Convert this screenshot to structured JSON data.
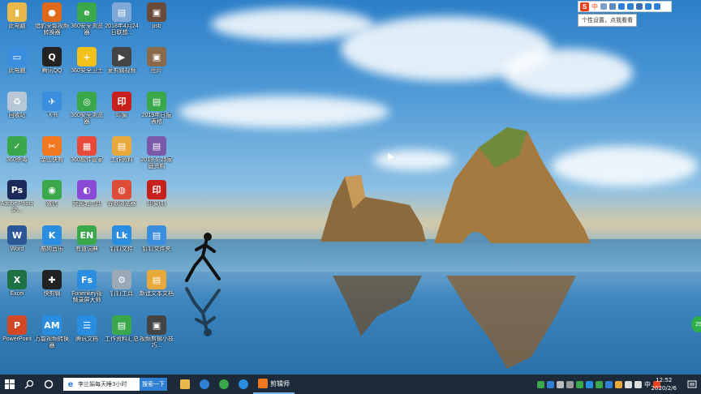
{
  "desktop": {
    "icons": [
      {
        "label": "此电脑",
        "icon": "folder-icon",
        "color": "#e8b94a",
        "glyph": "▮"
      },
      {
        "label": "猎豹全能视频转换器",
        "icon": "converter-icon",
        "color": "#e06a1b",
        "glyph": "●"
      },
      {
        "label": "360安全浏览器",
        "icon": "browser-360-icon",
        "color": "#3aa84a",
        "glyph": "e"
      },
      {
        "label": "2018年4月24日联想...",
        "icon": "document-icon",
        "color": "#7fa8d6",
        "glyph": "▤"
      },
      {
        "label": "psb",
        "icon": "image-thumb-icon",
        "color": "#6a4a3a",
        "glyph": "▣"
      },
      {
        "label": "此电脑",
        "icon": "computer-icon",
        "color": "#3b8ede",
        "glyph": "▭"
      },
      {
        "label": "腾讯QQ",
        "icon": "qq-icon",
        "color": "#222222",
        "glyph": "Q"
      },
      {
        "label": "360安全卫士",
        "icon": "shield-360-icon",
        "color": "#f2c21b",
        "glyph": "+"
      },
      {
        "label": "爱剪辑视频",
        "icon": "clapper-icon",
        "color": "#444444",
        "glyph": "▶"
      },
      {
        "label": "图片",
        "icon": "photo-icon",
        "color": "#8a6a4a",
        "glyph": "▣"
      },
      {
        "label": "回收站",
        "icon": "recycle-bin-icon",
        "color": "#b7c7d6",
        "glyph": "♻"
      },
      {
        "label": "飞书",
        "icon": "feishu-icon",
        "color": "#3b8ede",
        "glyph": "✈"
      },
      {
        "label": "360安全浏览器",
        "icon": "app-icon",
        "color": "#3aa84a",
        "glyph": "◎"
      },
      {
        "label": "印象",
        "icon": "stamp-icon",
        "color": "#c8201c",
        "glyph": "印"
      },
      {
        "label": "2019年日报表格",
        "icon": "spreadsheet-icon",
        "color": "#3aa84a",
        "glyph": "▤"
      },
      {
        "label": "360杀毒",
        "icon": "antivirus-icon",
        "color": "#3aa84a",
        "glyph": "✓"
      },
      {
        "label": "金山快剪",
        "icon": "scissors-icon",
        "color": "#f07820",
        "glyph": "✂"
      },
      {
        "label": "360软件管家",
        "icon": "software-manager-icon",
        "color": "#e84a3a",
        "glyph": "▦"
      },
      {
        "label": "工作资料",
        "icon": "document-icon",
        "color": "#e8a93a",
        "glyph": "▤"
      },
      {
        "label": "2019-6-25家庭资料",
        "icon": "document-icon",
        "color": "#7a5aa8",
        "glyph": "▤"
      },
      {
        "label": "Adobe Photosh...",
        "icon": "photoshop-icon",
        "color": "#1b2a5a",
        "glyph": "Ps"
      },
      {
        "label": "微信",
        "icon": "wechat-icon",
        "color": "#3aa84a",
        "glyph": "◉"
      },
      {
        "label": "荧光笔工具",
        "icon": "color-wheel-icon",
        "color": "#8a4ad6",
        "glyph": "◐"
      },
      {
        "label": "谷歌浏览器",
        "icon": "chrome-icon",
        "color": "#dd4b39",
        "glyph": "◍"
      },
      {
        "label": "印象(1)",
        "icon": "stamp-icon",
        "color": "#c8201c",
        "glyph": "印"
      },
      {
        "label": "Word",
        "icon": "word-icon",
        "color": "#2b5797",
        "glyph": "W"
      },
      {
        "label": "酷狗音乐",
        "icon": "kugou-icon",
        "color": "#2a8de0",
        "glyph": "K"
      },
      {
        "label": "有道词典",
        "icon": "dictionary-icon",
        "color": "#3aa84a",
        "glyph": "EN"
      },
      {
        "label": "钉钉文件",
        "icon": "link-icon",
        "color": "#2a8de0",
        "glyph": "Lk"
      },
      {
        "label": "钉钉文件夹",
        "icon": "document-icon",
        "color": "#3b8ede",
        "glyph": "▤"
      },
      {
        "label": "Excel",
        "icon": "excel-icon",
        "color": "#1e7145",
        "glyph": "X"
      },
      {
        "label": "快剪辑",
        "icon": "video-editor-icon",
        "color": "#222222",
        "glyph": "✚"
      },
      {
        "label": "Fonenkey视频录屏大师",
        "icon": "recorder-icon",
        "color": "#2a8de0",
        "glyph": "Fs"
      },
      {
        "label": "钉钉工具",
        "icon": "tool-icon",
        "color": "#9aa8b8",
        "glyph": "⚙"
      },
      {
        "label": "新建文本文档",
        "icon": "text-file-icon",
        "color": "#e8a93a",
        "glyph": "▤"
      },
      {
        "label": "PowerPoint",
        "icon": "powerpoint-icon",
        "color": "#d24726",
        "glyph": "P"
      },
      {
        "label": "万能视频转换器",
        "icon": "am-icon",
        "color": "#2a8de0",
        "glyph": "AM"
      },
      {
        "label": "腾讯文档",
        "icon": "docs-icon",
        "color": "#2a8de0",
        "glyph": "☰"
      },
      {
        "label": "工作资料汇总",
        "icon": "document-icon",
        "color": "#3aa84a",
        "glyph": "▤"
      },
      {
        "label": "视频剪辑小技巧...",
        "icon": "video-thumb-icon",
        "color": "#444444",
        "glyph": "▣"
      }
    ]
  },
  "ime": {
    "logo": "S",
    "mode": "中",
    "tooltip": "个性设置，点我看看"
  },
  "side_bubble": "25",
  "taskbar": {
    "search_text": "李兰娟每天睡3小时",
    "search_button": "搜索一下",
    "active_app_label": "剪辑师",
    "time": "12:52",
    "date": "2020/2/6",
    "ime_mode": "中"
  }
}
